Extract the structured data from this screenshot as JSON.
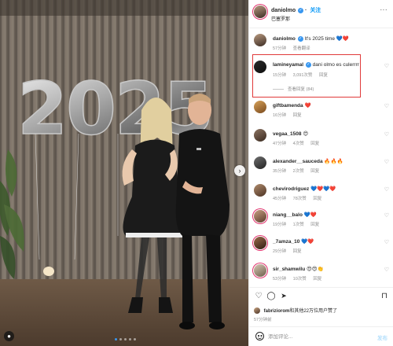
{
  "media": {
    "balloon_text": "2025",
    "dots_count": 5,
    "active_dot": 0,
    "next_glyph": "›",
    "user_tag_glyph": "●"
  },
  "header": {
    "username": "daniolmo",
    "verified_glyph": "✓",
    "follow_label": "关注",
    "location": "巴塞罗那",
    "more_glyph": "···"
  },
  "caption": {
    "username": "daniolmo",
    "text": "It's 2025 time",
    "emojis": "💙❤️",
    "meta": [
      "57分钟",
      "查看翻译"
    ]
  },
  "comments": [
    {
      "username": "lamineyamal",
      "verified": true,
      "text": "dani olmo es culerrrr",
      "time": "15分钟",
      "likes": "3,091次赞",
      "reply": "回复",
      "view_replies": "查看回复 (84)"
    },
    {
      "username": "giftbamenda",
      "verified": false,
      "text": "",
      "emojis": "❤️",
      "time": "16分钟",
      "likes": "",
      "reply": "回复"
    },
    {
      "username": "vegaa_1508",
      "verified": false,
      "text": "",
      "emojis": "😍",
      "time": "47分钟",
      "likes": "4次赞",
      "reply": "回复"
    },
    {
      "username": "alexander__sauceda",
      "verified": false,
      "text": "",
      "emojis": "🔥🔥🔥",
      "time": "35分钟",
      "likes": "2次赞",
      "reply": "回复"
    },
    {
      "username": "chevirodriguez",
      "verified": false,
      "text": "",
      "emojis": "💙❤️💙❤️",
      "time": "45分钟",
      "likes": "78次赞",
      "reply": "回复"
    },
    {
      "username": "niang__balo",
      "verified": false,
      "text": "",
      "emojis": "💙❤️",
      "time": "19分钟",
      "likes": "1次赞",
      "reply": "回复"
    },
    {
      "username": "_7amza_10",
      "verified": false,
      "text": "",
      "emojis": "💙❤️",
      "time": "29分钟",
      "likes": "",
      "reply": "回复"
    },
    {
      "username": "sir_shamwilu",
      "verified": false,
      "text": "",
      "emojis": "😍😍👏",
      "time": "53分钟",
      "likes": "10次赞",
      "reply": "回复"
    }
  ],
  "actions": {
    "like_glyph": "♡",
    "comment_glyph": "◯",
    "share_glyph": "➤",
    "save_glyph": "⊓",
    "liked_by_user": "fabriziorom",
    "liked_by_text": "和其他22万位用户赞了",
    "date": "57分钟前"
  },
  "add_comment": {
    "placeholder": "添加评论...",
    "post_label": "发布"
  },
  "colors": {
    "link_blue": "#0095f6",
    "verified_blue": "#3897f0",
    "highlight_red": "#e03a3a"
  }
}
